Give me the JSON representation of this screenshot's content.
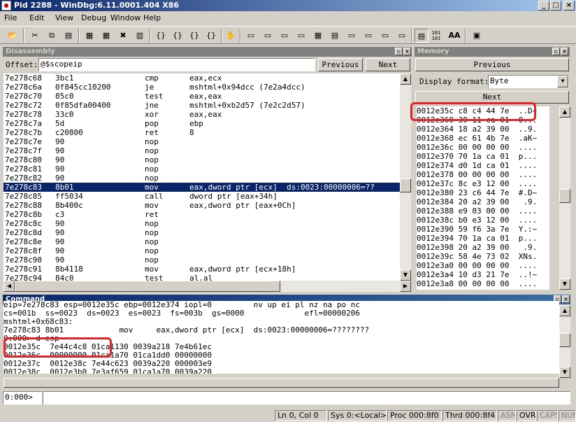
{
  "window": {
    "title": "Pid 2288 - WinDbg:6.11.0001.404 X86",
    "minimize": "_",
    "maximize": "□",
    "close": "×"
  },
  "menu": [
    "File",
    "Edit",
    "View",
    "Debug",
    "Window",
    "Help"
  ],
  "toolbar": {
    "icons": [
      "open-icon",
      "cut-icon",
      "copy-icon",
      "paste-icon",
      "go-icon",
      "restart-icon",
      "stop-icon",
      "break-icon",
      "step-into-icon",
      "step-over-icon",
      "step-out-icon",
      "run-to-cursor-icon",
      "hand-icon",
      "command-icon",
      "watch-icon",
      "locals-icon",
      "registers-icon",
      "memory-icon",
      "callstack-icon",
      "disassembly-icon",
      "scratchpad-icon",
      "source-mode-icon",
      "hex-icon",
      "font-icon",
      "options-icon"
    ],
    "hex_label": "101\n101",
    "font_label": "AA"
  },
  "disassembly": {
    "title": "Disassembly",
    "offset_label": "Offset:",
    "offset_value": "@$scopeip",
    "previous": "Previous",
    "next": "Next",
    "rows": [
      [
        "7e278c68",
        "3bc1",
        "cmp",
        "eax,ecx"
      ],
      [
        "7e278c6a",
        "0f845cc10200",
        "je",
        "mshtml+0x94dcc (7e2a4dcc)"
      ],
      [
        "7e278c70",
        "85c0",
        "test",
        "eax,eax"
      ],
      [
        "7e278c72",
        "0f85dfa00400",
        "jne",
        "mshtml+0xb2d57 (7e2c2d57)"
      ],
      [
        "7e278c78",
        "33c0",
        "xor",
        "eax,eax"
      ],
      [
        "7e278c7a",
        "5d",
        "pop",
        "ebp"
      ],
      [
        "7e278c7b",
        "c20800",
        "ret",
        "8"
      ],
      [
        "7e278c7e",
        "90",
        "nop",
        ""
      ],
      [
        "7e278c7f",
        "90",
        "nop",
        ""
      ],
      [
        "7e278c80",
        "90",
        "nop",
        ""
      ],
      [
        "7e278c81",
        "90",
        "nop",
        ""
      ],
      [
        "7e278c82",
        "90",
        "nop",
        ""
      ],
      [
        "7e278c83",
        "8b01",
        "mov",
        "eax,dword ptr [ecx]  ds:0023:00000006=??"
      ],
      [
        "7e278c85",
        "ff5034",
        "call",
        "dword ptr [eax+34h]"
      ],
      [
        "7e278c88",
        "8b400c",
        "mov",
        "eax,dword ptr [eax+0Ch]"
      ],
      [
        "7e278c8b",
        "c3",
        "ret",
        ""
      ],
      [
        "7e278c8c",
        "90",
        "nop",
        ""
      ],
      [
        "7e278c8d",
        "90",
        "nop",
        ""
      ],
      [
        "7e278c8e",
        "90",
        "nop",
        ""
      ],
      [
        "7e278c8f",
        "90",
        "nop",
        ""
      ],
      [
        "7e278c90",
        "90",
        "nop",
        ""
      ],
      [
        "7e278c91",
        "8b4118",
        "mov",
        "eax,dword ptr [ecx+18h]"
      ],
      [
        "7e278c94",
        "84c0",
        "test",
        "al,al"
      ]
    ],
    "selected_index": 12
  },
  "memory": {
    "title": "Memory",
    "previous": "Previous",
    "display_format_label": "Display format:",
    "display_format_value": "Byte",
    "next": "Next",
    "rows": [
      "0012e35c c8 c4 44 7e  ..D~",
      "0012e360 30 11 ca 01  0...",
      "0012e364 18 a2 39 00  ..9.",
      "0012e368 ec 61 4b 7e  .aK~",
      "0012e36c 00 00 00 00  ....",
      "0012e370 70 1a ca 01  p...",
      "0012e374 d0 1d ca 01  ....",
      "0012e378 00 00 00 00  ....",
      "0012e37c 8c e3 12 00  ....",
      "0012e380 23 c6 44 7e  #.D~",
      "0012e384 20 a2 39 00   .9.",
      "0012e388 e9 03 00 00  ....",
      "0012e38c b0 e3 12 00  ....",
      "0012e390 59 f6 3a 7e  Y.:~",
      "0012e394 70 1a ca 01  p...",
      "0012e398 20 a2 39 00   .9.",
      "0012e39c 58 4e 73 02  XNs.",
      "0012e3a0 00 00 00 00  ....",
      "0012e3a4 10 d3 21 7e  ..!~",
      "0012e3a8 00 00 00 00  ...."
    ]
  },
  "command": {
    "title": "Command",
    "lines": [
      "eip=7e278c83 esp=0012e35c ebp=0012e374 iopl=0         nv up ei pl nz na po nc",
      "cs=001b  ss=0023  ds=0023  es=0023  fs=003b  gs=0000             efl=00000206",
      "mshtml+0x68c83:",
      "7e278c83 8b01            mov     eax,dword ptr [ecx]  ds:0023:00000006=????????",
      "0:000> d esp",
      "0012e35c  7e44c4c8 01ca1130 0039a218 7e4b61ec",
      "0012e36c  00000000 01ca1a70 01ca1dd0 00000000",
      "0012e37c  0012e38c 7e44c623 0039a220 000003e9",
      "0012e38c  0012e3b0 7e3af659 01ca1a70 0039a220"
    ],
    "prompt": "0:000>",
    "input_value": ""
  },
  "status": {
    "position": "Ln 0, Col 0",
    "sys": "Sys 0:<Local>",
    "proc": "Proc 000:8f0",
    "thrd": "Thrd 000:8f4",
    "asm": "ASM",
    "ovr": "OVR",
    "caps": "CAPS",
    "num": "NUM"
  },
  "colors": {
    "highlight": "#e3242b",
    "selection": "#0a246a",
    "title_gradient_start": "#0a246a",
    "title_gradient_end": "#a6caf0"
  }
}
